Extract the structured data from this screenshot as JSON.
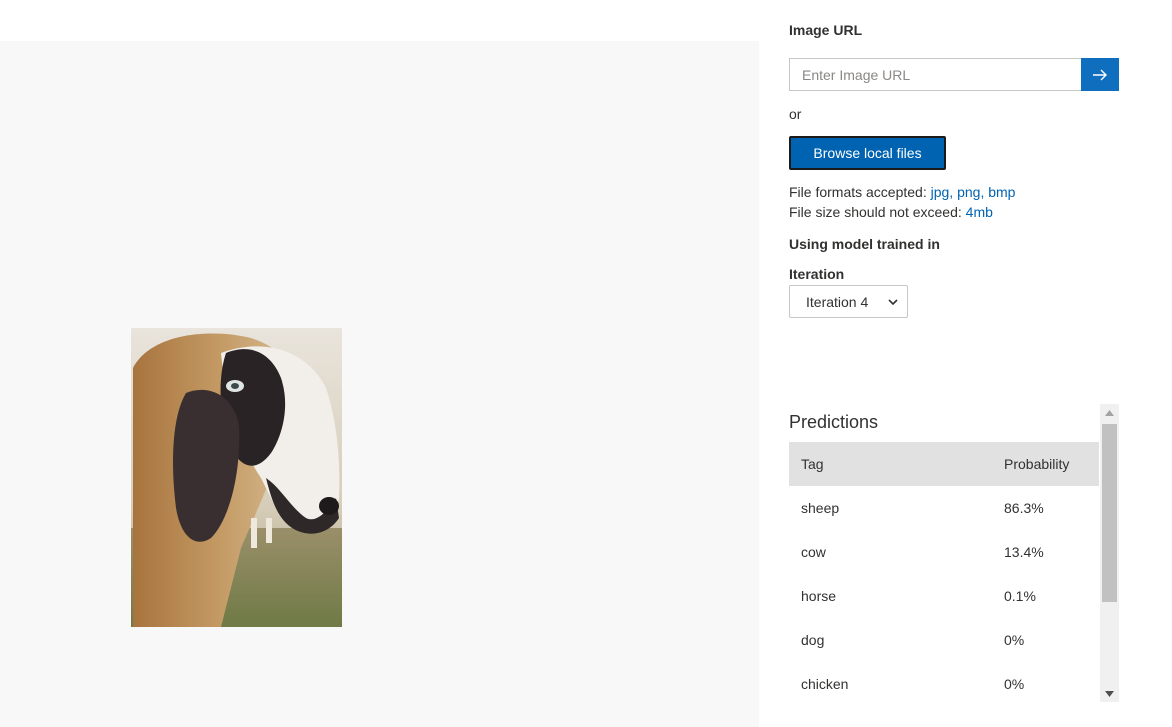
{
  "image_url": {
    "label": "Image URL",
    "placeholder": "Enter Image URL",
    "submit_icon": "arrow-right-icon"
  },
  "or_label": "or",
  "browse_button": "Browse local files",
  "file_info": {
    "formats_prefix": "File formats accepted: ",
    "formats": "jpg, png, bmp",
    "size_prefix": "File size should not exceed: ",
    "size": "4mb"
  },
  "model_label": "Using model trained in",
  "iteration": {
    "label": "Iteration",
    "selected": "Iteration 4"
  },
  "predictions": {
    "title": "Predictions",
    "columns": [
      "Tag",
      "Probability"
    ],
    "rows": [
      {
        "tag": "sheep",
        "probability": "86.3%"
      },
      {
        "tag": "cow",
        "probability": "13.4%"
      },
      {
        "tag": "horse",
        "probability": "0.1%"
      },
      {
        "tag": "dog",
        "probability": "0%"
      },
      {
        "tag": "chicken",
        "probability": "0%"
      }
    ]
  },
  "colors": {
    "accent": "#0063b1",
    "header_bg": "#e1e1e1",
    "canvas_bg": "#f8f8f8"
  }
}
